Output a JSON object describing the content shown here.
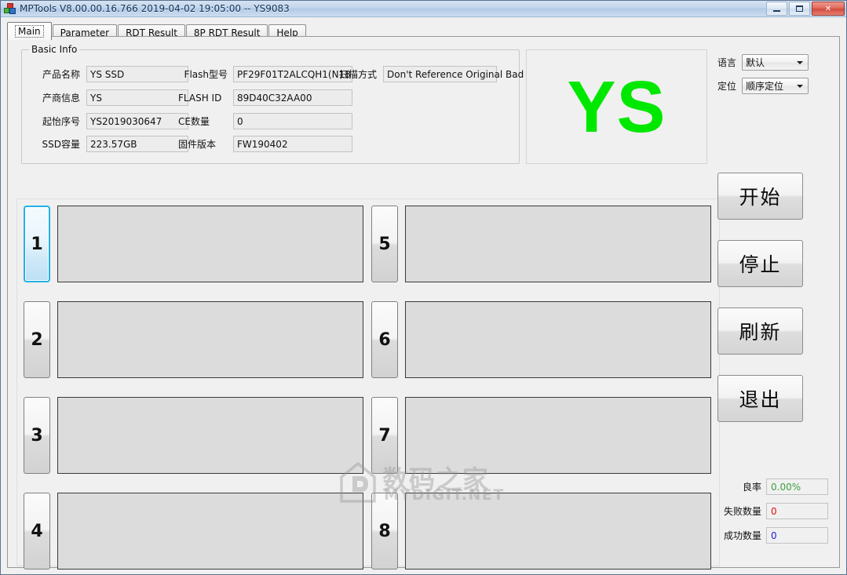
{
  "window": {
    "title": "MPTools V8.00.00.16.766 2019-04-02 19:05:00  -- YS9083",
    "minimize_label": "Minimize",
    "maximize_label": "Maximize",
    "close_label": "✕"
  },
  "tabs": [
    {
      "label": "Main",
      "active": true
    },
    {
      "label": "Parameter",
      "active": false
    },
    {
      "label": "RDT Result",
      "active": false
    },
    {
      "label": "8P RDT Result",
      "active": false
    },
    {
      "label": "Help",
      "active": false
    }
  ],
  "basic_info": {
    "legend": "Basic Info",
    "fields": [
      {
        "label": "产品名称",
        "value": "YS SSD"
      },
      {
        "label": "产商信息",
        "value": "YS"
      },
      {
        "label": "起怡序号",
        "value": "YS2019030647"
      },
      {
        "label": "SSD容量",
        "value": "223.57GB"
      },
      {
        "label": "Flash型号",
        "value": "PF29F01T2ALCQH1(N18)"
      },
      {
        "label": "FLASH ID",
        "value": "89D40C32AA00"
      },
      {
        "label": "CE数量",
        "value": "0"
      },
      {
        "label": "固件版本",
        "value": "FW190402"
      }
    ],
    "scan_mode": {
      "label": "扫描方式",
      "value": "Don't Reference Original Bad"
    }
  },
  "logo": {
    "text": "YS",
    "color": "#00e800"
  },
  "settings": [
    {
      "label": "语言",
      "value": "默认"
    },
    {
      "label": "定位",
      "value": "顺序定位"
    }
  ],
  "slots": [
    {
      "number": "1",
      "selected": true
    },
    {
      "number": "2",
      "selected": false
    },
    {
      "number": "3",
      "selected": false
    },
    {
      "number": "4",
      "selected": false
    },
    {
      "number": "5",
      "selected": false
    },
    {
      "number": "6",
      "selected": false
    },
    {
      "number": "7",
      "selected": false
    },
    {
      "number": "8",
      "selected": false
    }
  ],
  "buttons": [
    {
      "label": "开始"
    },
    {
      "label": "停止"
    },
    {
      "label": "刷新"
    },
    {
      "label": "退出"
    }
  ],
  "stats": [
    {
      "label": "良率",
      "value": "0.00%",
      "color": "#3fa03f"
    },
    {
      "label": "失败数量",
      "value": "0",
      "color": "#e01010"
    },
    {
      "label": "成功数量",
      "value": "0",
      "color": "#2020e0"
    }
  ],
  "watermark": {
    "cn": "数码之家",
    "en": "MYDIGIT.NET"
  }
}
